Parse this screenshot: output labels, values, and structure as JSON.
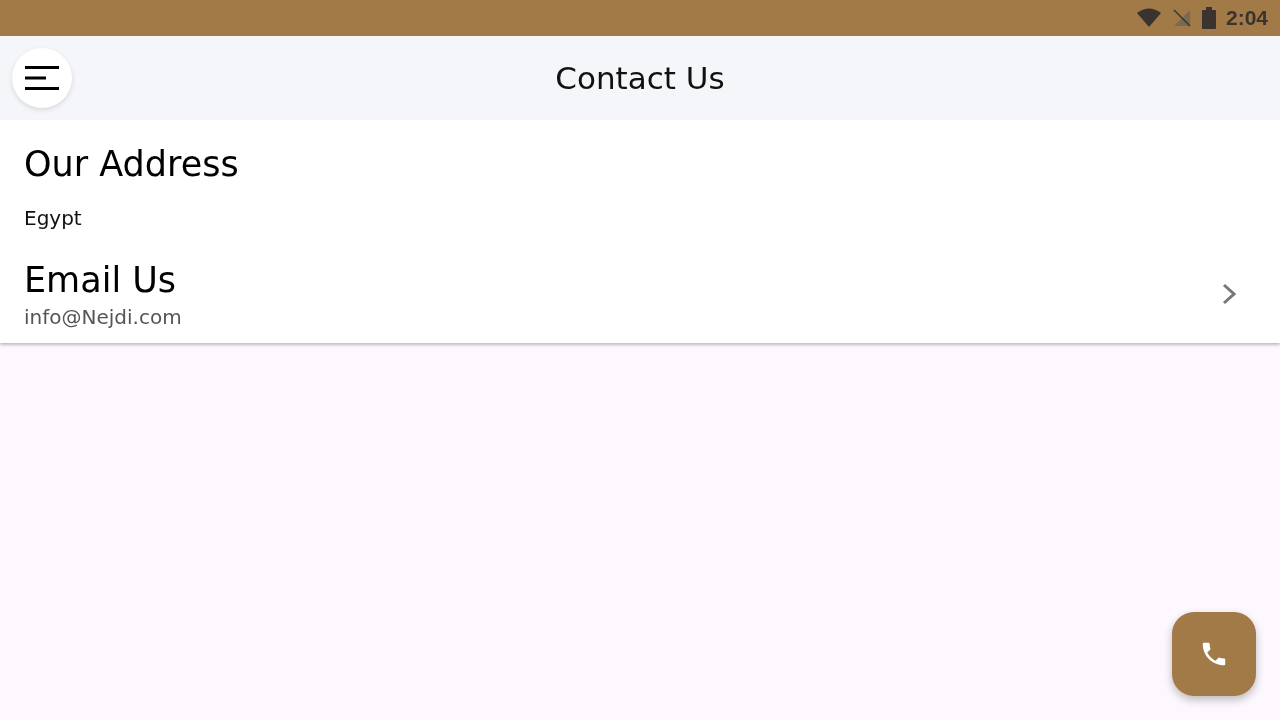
{
  "status_bar": {
    "time": "2:04"
  },
  "app_bar": {
    "title": "Contact Us"
  },
  "sections": [
    {
      "kind": "plain",
      "heading": "Our Address",
      "text": "Egypt"
    },
    {
      "kind": "link",
      "heading": "Email Us",
      "text": "info@Nejdi.com"
    }
  ]
}
